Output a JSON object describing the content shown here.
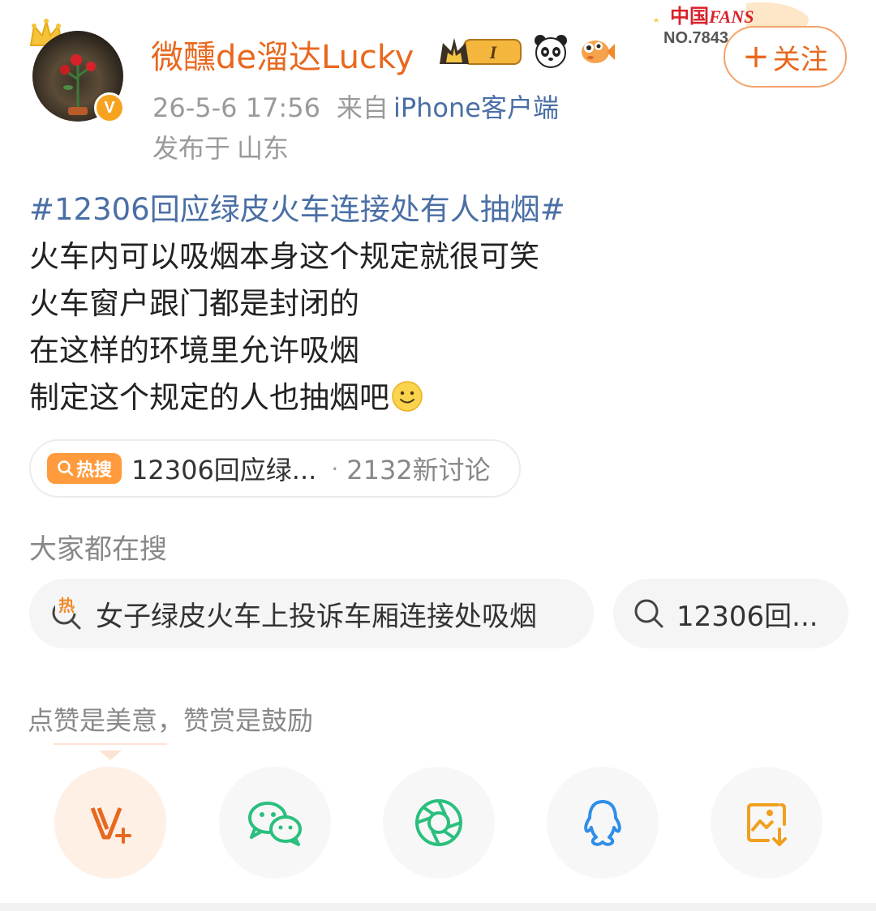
{
  "user": {
    "name": "微醺de溜达Lucky",
    "verified_mark": "V",
    "level_mark": "I"
  },
  "post_meta": {
    "timestamp": "26-5-6 17:56",
    "from_label": "来自",
    "source": "iPhone客户端",
    "location_label": "发布于",
    "location": "山东"
  },
  "fans_badge": {
    "no": "NO.7843"
  },
  "follow_button": {
    "plus": "+",
    "label": "关注"
  },
  "post": {
    "hashtag": "#12306回应绿皮火车连接处有人抽烟#",
    "lines": [
      "火车内可以吸烟本身这个规定就很可笑",
      "火车窗户跟门都是封闭的",
      "在这样的环境里允许吸烟",
      "制定这个规定的人也抽烟吧"
    ]
  },
  "hot_search": {
    "tag": "热搜",
    "title": "12306回应绿...",
    "dot": "·",
    "count": "2132新讨论"
  },
  "everyone_search": {
    "heading": "大家都在搜",
    "chips": [
      {
        "hot_mark": "热",
        "text": "女子绿皮火车上投诉车厢连接处吸烟"
      },
      {
        "text": "12306回..."
      }
    ]
  },
  "reward": {
    "note": "点赞是美意，赞赏是鼓励"
  },
  "share_icons": [
    "v-plus-icon",
    "wechat-icon",
    "moments-icon",
    "qq-icon",
    "save-image-icon"
  ],
  "colors": {
    "accent": "#e8681e",
    "link": "#4a6fa5",
    "hot": "#ff9b3d",
    "wechat": "#2bbf7d",
    "qq": "#2f8fe8",
    "save": "#f0a020"
  }
}
